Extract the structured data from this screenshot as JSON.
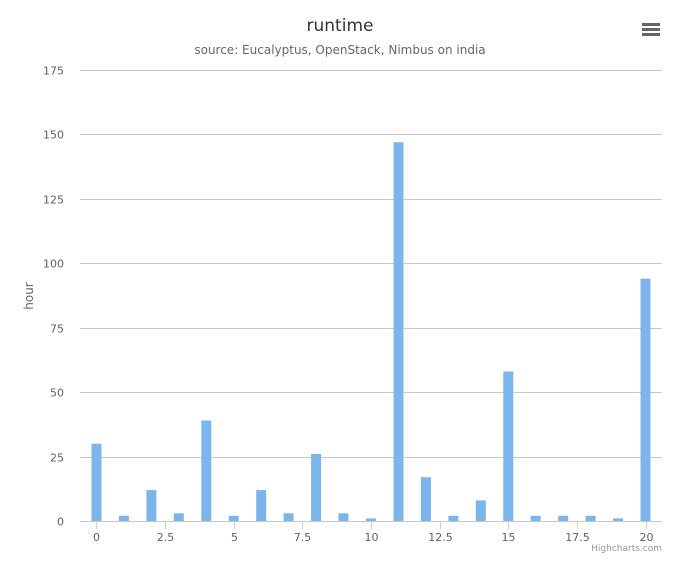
{
  "chart_data": {
    "type": "bar",
    "title": "runtime",
    "subtitle": "source: Eucalyptus, OpenStack, Nimbus on india",
    "ylabel": "hour",
    "xlabel": "",
    "x": [
      0,
      1,
      2,
      3,
      4,
      5,
      6,
      7,
      8,
      9,
      10,
      11,
      12,
      13,
      14,
      15,
      16,
      17,
      18,
      19,
      20
    ],
    "values": [
      30,
      2,
      12,
      3,
      39,
      2,
      12,
      3,
      26,
      3,
      1,
      147,
      17,
      2,
      8,
      58,
      2,
      2,
      2,
      1,
      94
    ],
    "xlim": [
      -0.6,
      20.6
    ],
    "ylim": [
      0,
      175
    ],
    "x_ticks": [
      0,
      2.5,
      5,
      7.5,
      10,
      12.5,
      15,
      17.5,
      20
    ],
    "x_tick_labels": [
      "0",
      "2.5",
      "5",
      "7.5",
      "10",
      "12.5",
      "15",
      "17.5",
      "20"
    ],
    "y_ticks": [
      0,
      25,
      50,
      75,
      100,
      125,
      150,
      175
    ],
    "y_tick_labels": [
      "0",
      "25",
      "50",
      "75",
      "100",
      "125",
      "150",
      "175"
    ],
    "grid": true,
    "legend": "none",
    "bar_color": "#7cb5ec"
  },
  "credits": "Highcharts.com",
  "menu_icon": "hamburger-menu-icon"
}
